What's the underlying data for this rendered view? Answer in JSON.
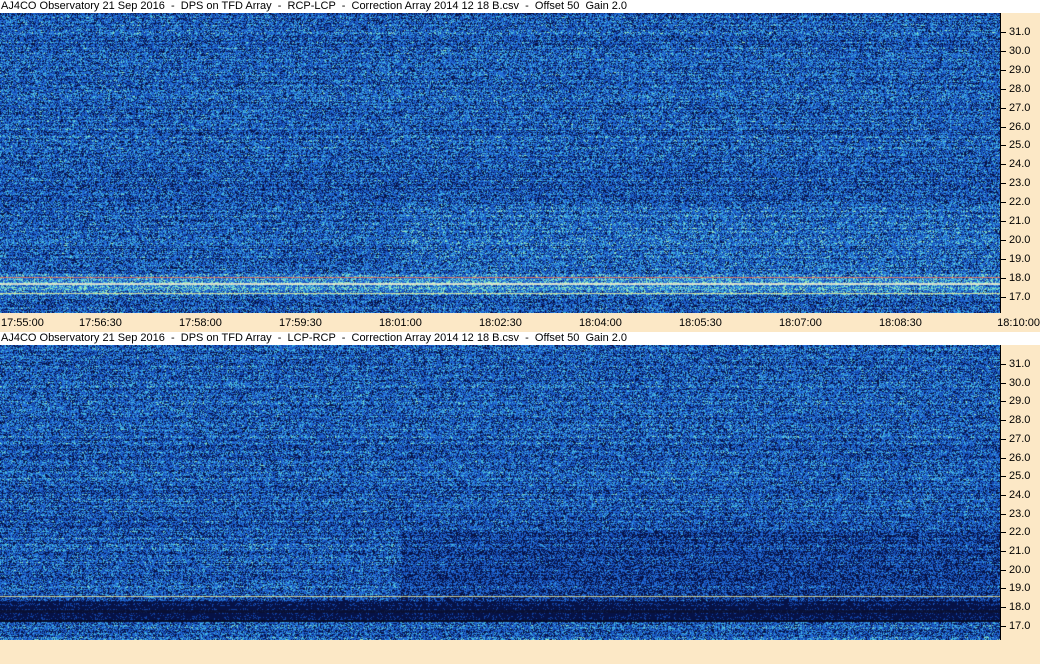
{
  "panels": [
    {
      "title": "AJ4CO Observatory 21 Sep 2016  -  DPS on TFD Array  -  RCP-LCP  -  Correction Array 2014 12 18 B.csv  -  Offset 50  Gain 2.0",
      "polarity": "bright"
    },
    {
      "title": "AJ4CO Observatory 21 Sep 2016  -  DPS on TFD Array  -  LCP-RCP  -  Correction Array 2014 12 18 B.csv  -  Offset 50  Gain 2.0",
      "polarity": "dark"
    }
  ],
  "freq_labels": [
    "31.0",
    "30.0",
    "29.0",
    "28.0",
    "27.0",
    "26.0",
    "25.0",
    "24.0",
    "23.0",
    "22.0",
    "21.0",
    "20.0",
    "19.0",
    "18.0",
    "17.0"
  ],
  "time_labels": [
    "17:55:00",
    "17:56:30",
    "17:58:00",
    "17:59:30",
    "18:01:00",
    "18:02:30",
    "18:04:00",
    "18:05:30",
    "18:07:00",
    "18:08:30",
    "18:10:00"
  ],
  "colors": {
    "axis_background": "#fce8c6",
    "spectrogram_base": "#1f5fc0",
    "spectrogram_dark": "#0a1f5a",
    "spectrogram_bright": "#4fd3e0",
    "signal_highlight": "#f4f09a"
  }
}
